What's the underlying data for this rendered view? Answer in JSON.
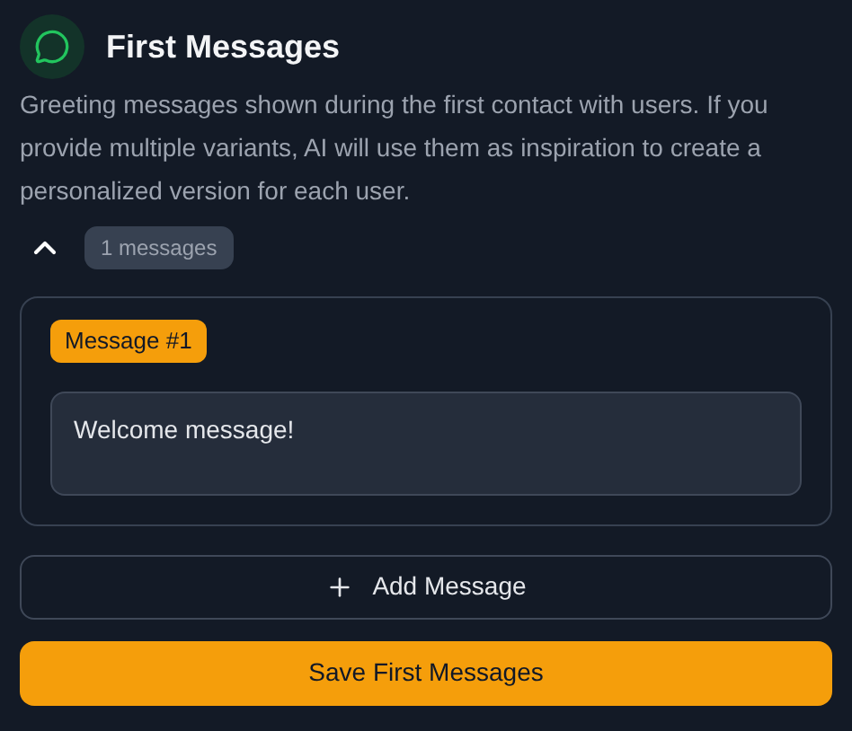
{
  "header": {
    "title": "First Messages",
    "description": "Greeting messages shown during the first contact with users. If you provide multiple variants, AI will use them as inspiration to create a personalized version for each user."
  },
  "collapse": {
    "expanded": true,
    "count": "1 messages"
  },
  "messages": [
    {
      "label": "Message #1",
      "value": "Welcome message!"
    }
  ],
  "add_button": "Add Message",
  "save_button": "Save First Messages"
}
